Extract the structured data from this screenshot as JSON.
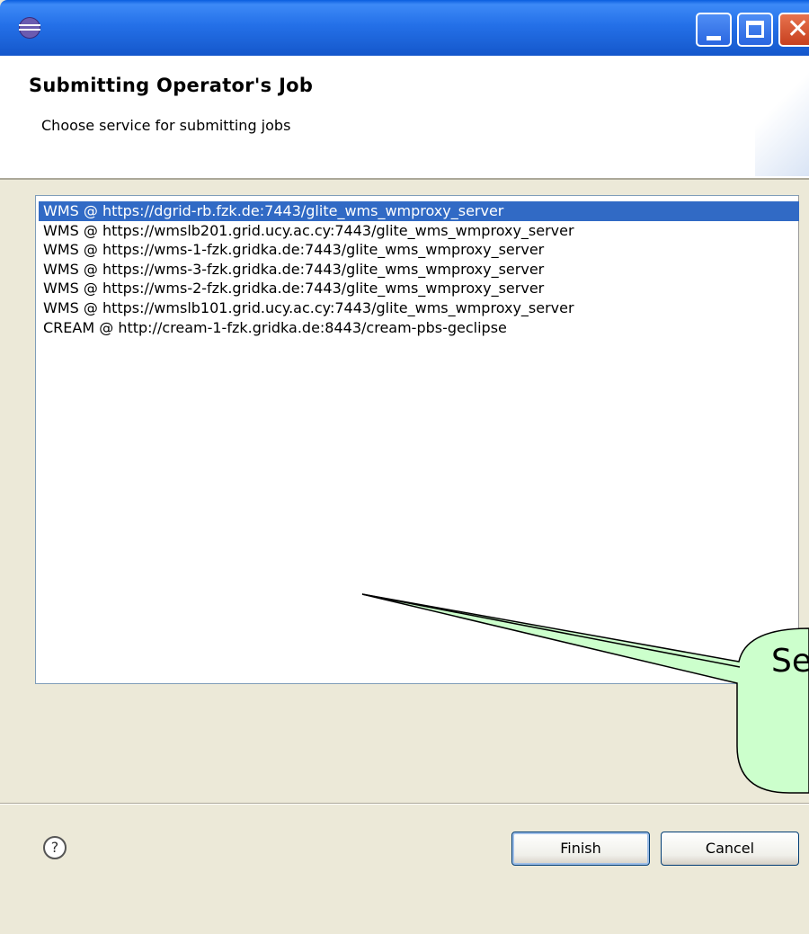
{
  "window": {
    "title": "",
    "accent": "#2470e8"
  },
  "header": {
    "title": "Submitting Operator's Job",
    "subtitle": "Choose service for submitting jobs"
  },
  "service_list": {
    "selected_index": 0,
    "items": [
      "WMS @ https://dgrid-rb.fzk.de:7443/glite_wms_wmproxy_server",
      "WMS @ https://wmslb201.grid.ucy.ac.cy:7443/glite_wms_wmproxy_server",
      "WMS @ https://wms-1-fzk.gridka.de:7443/glite_wms_wmproxy_server",
      "WMS @ https://wms-3-fzk.gridka.de:7443/glite_wms_wmproxy_server",
      "WMS @ https://wms-2-fzk.gridka.de:7443/glite_wms_wmproxy_server",
      "WMS @ https://wmslb101.grid.ucy.ac.cy:7443/glite_wms_wmproxy_server",
      "CREAM @ http://cream-1-fzk.gridka.de:8443/cream-pbs-geclipse"
    ]
  },
  "callout": {
    "line1": "Se",
    "line2": "",
    "color": "#ccffcc"
  },
  "footer": {
    "help_icon": "help-icon",
    "finish_label": "Finish",
    "cancel_label": "Cancel"
  }
}
